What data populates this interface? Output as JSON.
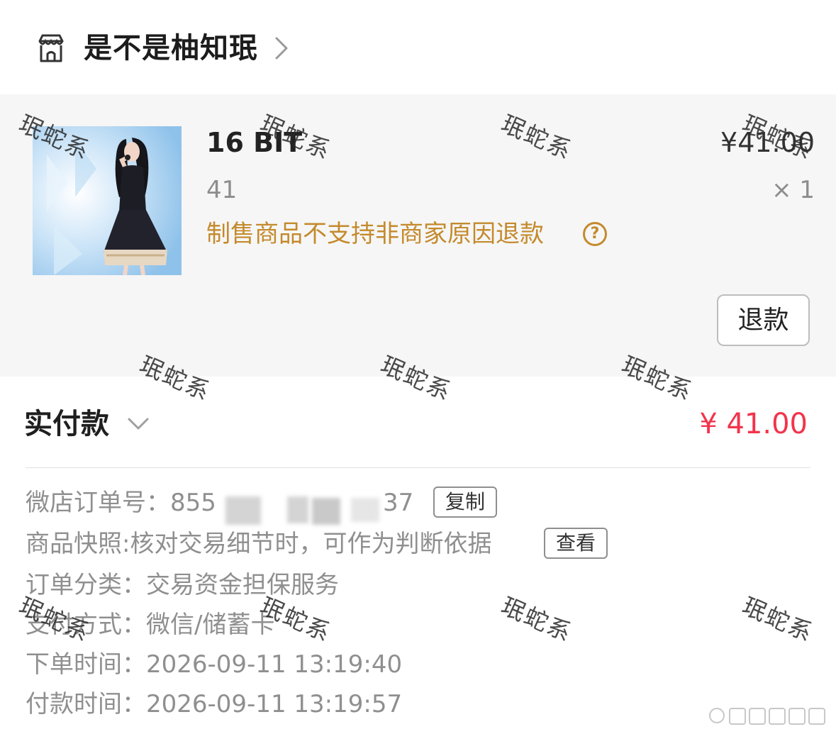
{
  "shop": {
    "name": "是不是柚知珉"
  },
  "product": {
    "title": "16 BIT",
    "price": "¥41.00",
    "spec": "41",
    "quantity": "× 1",
    "notice": "制售商品不支持非商家原因退款",
    "refund_label": "退款"
  },
  "payment": {
    "label": "实付款",
    "amount": "¥ 41.00",
    "amount_color": "#f2344c"
  },
  "order_info": {
    "order_no_label": "微店订单号：",
    "order_no_prefix": "855",
    "order_no_suffix": "37",
    "copy_label": "复制",
    "snapshot_label": "商品快照: ",
    "snapshot_value": "核对交易细节时，可作为判断依据",
    "view_label": "查看",
    "category_label": "订单分类：",
    "category_value": "交易资金担保服务",
    "pay_method_label": "支付方式：",
    "pay_method_value": "微信/储蓄卡",
    "order_time_label": "下单时间：",
    "order_time_value": "2026-09-11 13:19:40",
    "pay_time_label": "付款时间：",
    "pay_time_value": "2026-09-11 13:19:57"
  },
  "watermark_text": "珉蛇系",
  "colors": {
    "notice": "#c48a2c",
    "card_bg": "#f6f6f6",
    "muted": "#8f8f8f"
  }
}
